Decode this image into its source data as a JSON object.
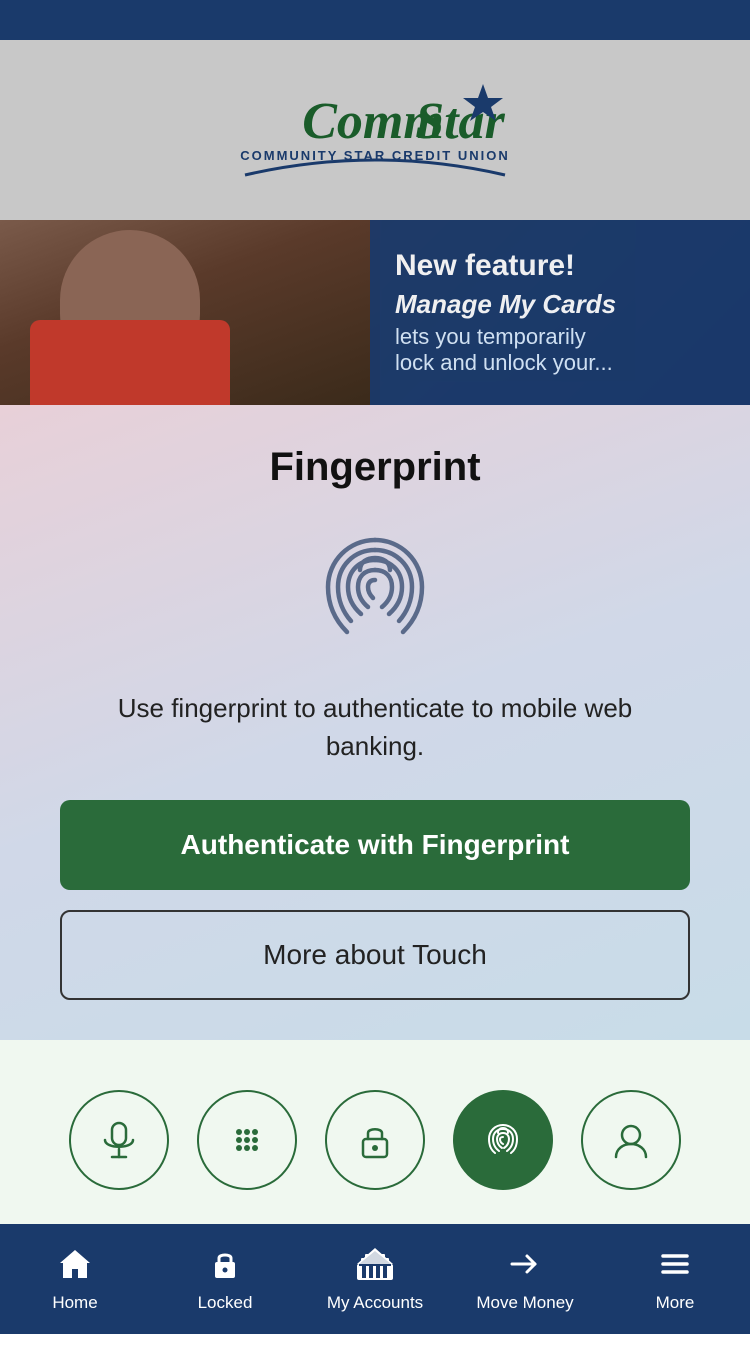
{
  "header": {
    "logo_main": "CommStar",
    "logo_sub": "COMMUNITY STAR CREDIT UNION"
  },
  "banner": {
    "new_feature": "New feature!",
    "manage_label": "Manage My Cards",
    "desc": "lets you temporarily",
    "desc2": "lock and unlock your..."
  },
  "fingerprint": {
    "title": "Fingerprint",
    "description": "Use fingerprint to authenticate to mobile web banking.",
    "btn_authenticate": "Authenticate with Fingerprint",
    "btn_touch": "More about Touch"
  },
  "auth_icons": [
    {
      "name": "microphone",
      "symbol": "🎙",
      "label": "voice",
      "active": false
    },
    {
      "name": "keypad",
      "symbol": "⠿",
      "label": "keypad",
      "active": false
    },
    {
      "name": "lock",
      "symbol": "🔒",
      "label": "lock",
      "active": false
    },
    {
      "name": "fingerprint",
      "symbol": "✦",
      "label": "fingerprint",
      "active": true
    },
    {
      "name": "face",
      "symbol": "👤",
      "label": "face",
      "active": false
    }
  ],
  "bottom_nav": {
    "items": [
      {
        "label": "Home",
        "icon": "🏠"
      },
      {
        "label": "Locked",
        "icon": "🔒"
      },
      {
        "label": "My Accounts",
        "icon": "🏛"
      },
      {
        "label": "Move Money",
        "icon": "✈"
      },
      {
        "label": "More",
        "icon": "☰"
      }
    ]
  }
}
